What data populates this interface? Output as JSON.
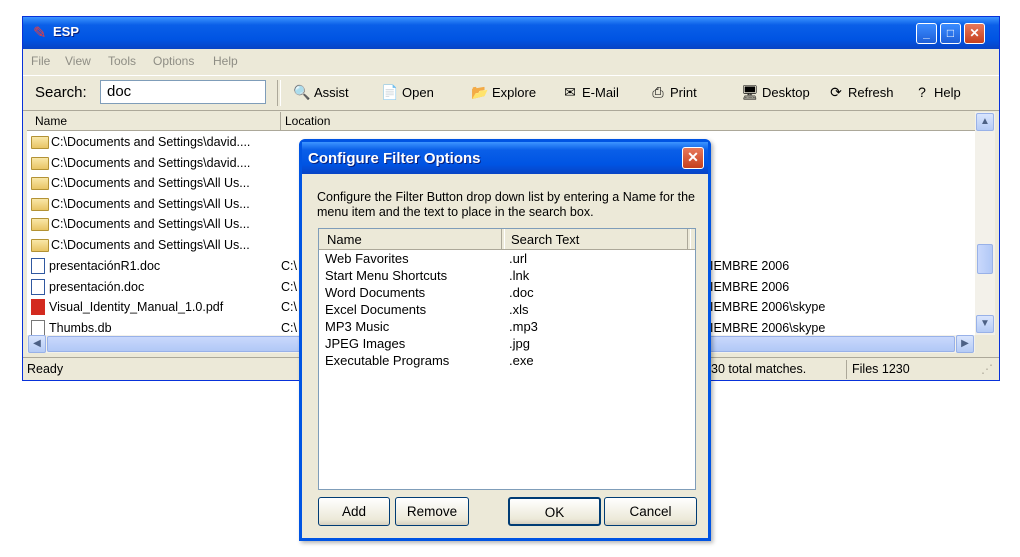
{
  "app": {
    "title": "ESP"
  },
  "menu": [
    "File",
    "View",
    "Tools",
    "Options",
    "Help"
  ],
  "search": {
    "label": "Search:",
    "value": "doc"
  },
  "toolbar": {
    "assist": "Assist",
    "open": "Open",
    "explore": "Explore",
    "email": "E-Mail",
    "print": "Print",
    "desktop": "Desktop",
    "refresh": "Refresh",
    "help": "Help"
  },
  "list": {
    "columns": {
      "name": "Name",
      "location": "Location"
    },
    "rows": [
      {
        "name": "C:\\Documents and Settings\\david....",
        "loc": ""
      },
      {
        "name": "C:\\Documents and Settings\\david....",
        "loc": ""
      },
      {
        "name": "C:\\Documents and Settings\\All Us...",
        "loc": ""
      },
      {
        "name": "C:\\Documents and Settings\\All Us...",
        "loc": ""
      },
      {
        "name": "C:\\Documents and Settings\\All Us...",
        "loc": ""
      },
      {
        "name": "C:\\Documents and Settings\\All Us...",
        "loc": ""
      },
      {
        "name": "presentaciónR1.doc",
        "loc": "C:\\",
        "loc_end": "IEMBRE 2006"
      },
      {
        "name": "presentación.doc",
        "loc": "C:\\",
        "loc_end": "IEMBRE 2006"
      },
      {
        "name": "Visual_Identity_Manual_1.0.pdf",
        "loc": "C:\\",
        "loc_end": "IEMBRE 2006\\skype"
      },
      {
        "name": "Thumbs.db",
        "loc": "C:\\",
        "loc_end": "IEMBRE 2006\\skype"
      }
    ]
  },
  "status": {
    "ready": "Ready",
    "matches": "30 total matches.",
    "files": "Files 1230"
  },
  "dialog": {
    "title": "Configure Filter Options",
    "description": "Configure the Filter Button drop down list by entering a Name for the menu item and the text to place in the search box.",
    "columns": {
      "name": "Name",
      "search_text": "Search Text"
    },
    "filters": [
      {
        "name": "Web Favorites",
        "text": ".url"
      },
      {
        "name": "Start Menu Shortcuts",
        "text": ".lnk"
      },
      {
        "name": "Word Documents",
        "text": ".doc"
      },
      {
        "name": "Excel Documents",
        "text": ".xls"
      },
      {
        "name": "MP3 Music",
        "text": ".mp3"
      },
      {
        "name": "JPEG Images",
        "text": ".jpg"
      },
      {
        "name": "Executable Programs",
        "text": ".exe"
      }
    ],
    "buttons": {
      "add": "Add",
      "remove": "Remove",
      "ok": "OK",
      "cancel": "Cancel"
    }
  },
  "colors": {
    "titlebar": "#0054e3",
    "window_bg": "#ece9d8",
    "close_red": "#c5401e"
  }
}
